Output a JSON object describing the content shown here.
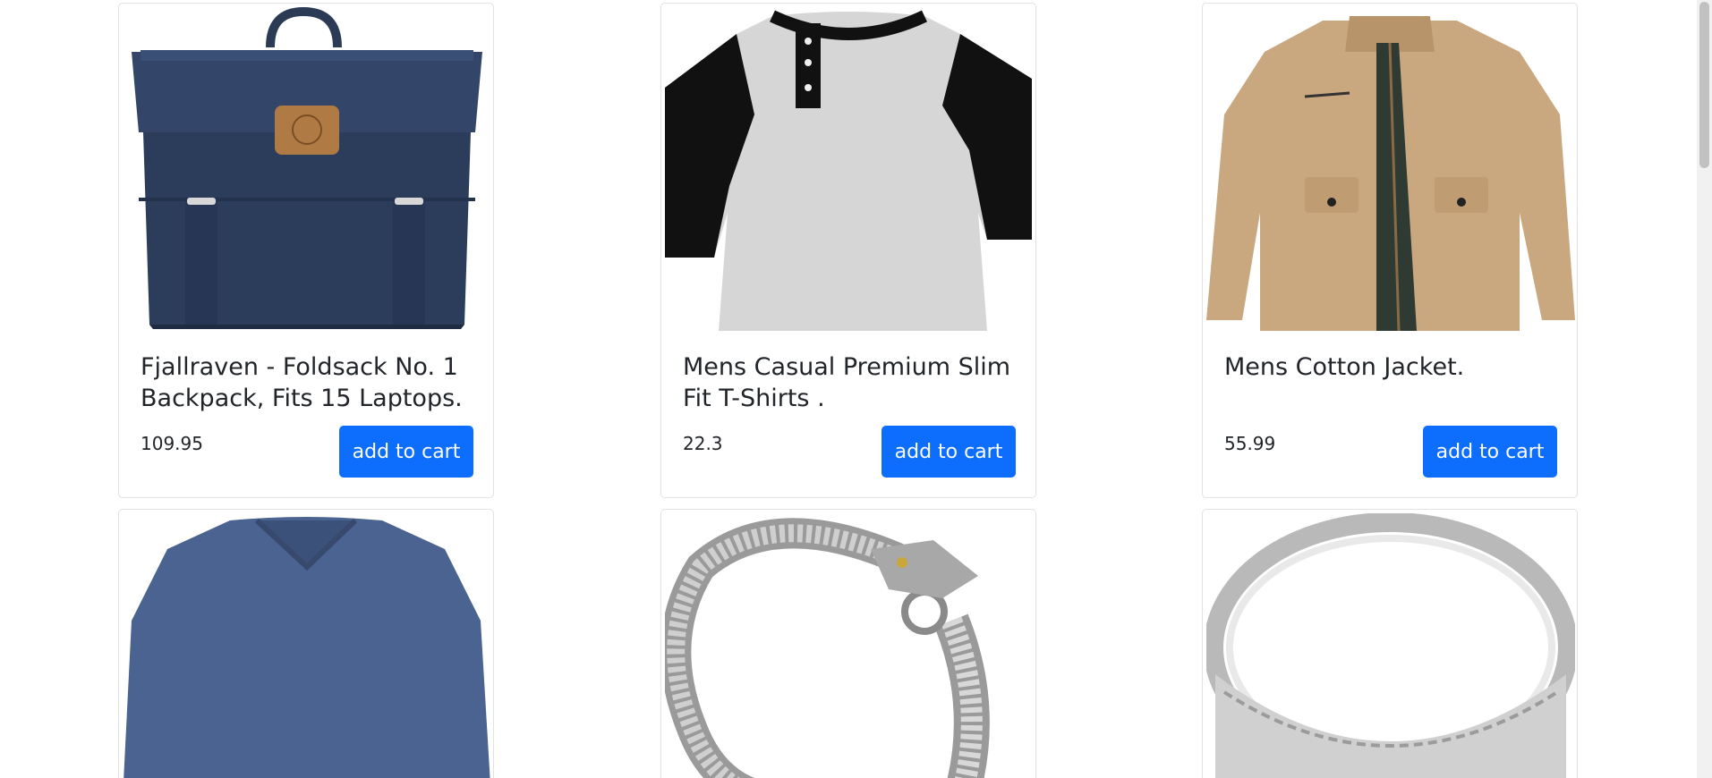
{
  "products": [
    {
      "title": "Fjallraven - Foldsack No. 1 Backpack, Fits 15 Laptops.",
      "price": "109.95",
      "button_label": "add to cart",
      "image": "backpack-image"
    },
    {
      "title": "Mens Casual Premium Slim Fit T-Shirts .",
      "price": "22.3",
      "button_label": "add to cart",
      "image": "tshirt-image"
    },
    {
      "title": "Mens Cotton Jacket.",
      "price": "55.99",
      "button_label": "add to cart",
      "image": "jacket-image"
    },
    {
      "image": "long-sleeve-shirt-image"
    },
    {
      "image": "dragon-bracelet-image"
    },
    {
      "image": "silver-ring-image"
    }
  ],
  "colors": {
    "primary_button": "#0d6efd",
    "card_border": "#dfe2e6",
    "text": "#212529"
  }
}
